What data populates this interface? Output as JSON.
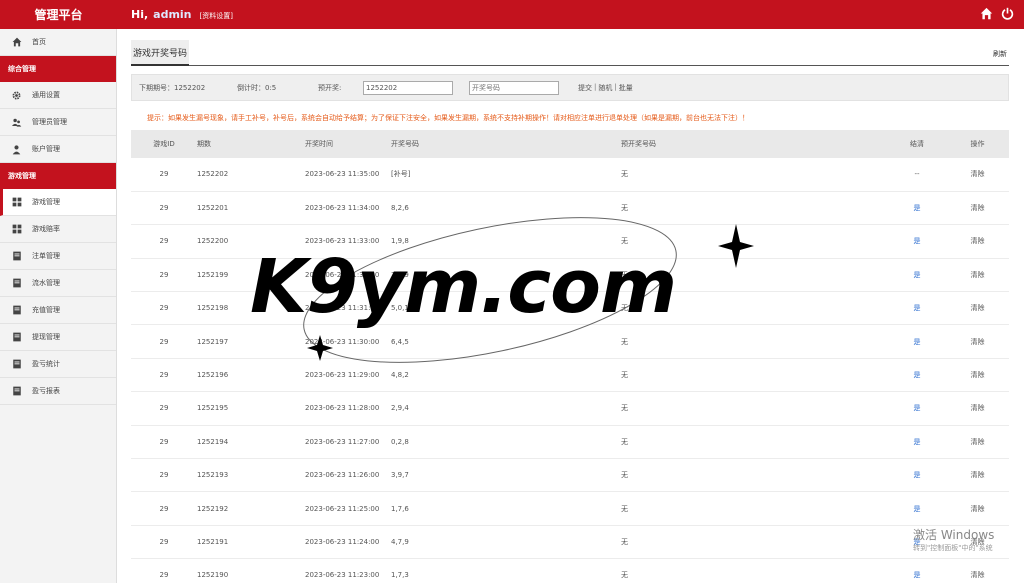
{
  "header": {
    "brand": "管理平台",
    "greeting": "Hi,",
    "username": "admin",
    "profile_link": "[资料设置]",
    "icons": [
      "home-icon",
      "power-icon"
    ]
  },
  "sidebar": {
    "items_top": [
      {
        "label": "首页",
        "icon": "home-icon"
      }
    ],
    "section1": "综合管理",
    "items_s1": [
      {
        "label": "通用设置",
        "icon": "gear-icon"
      },
      {
        "label": "管理员管理",
        "icon": "users-icon"
      },
      {
        "label": "账户管理",
        "icon": "user-icon"
      }
    ],
    "section2": "游戏管理",
    "items_s2": [
      {
        "label": "游戏管理",
        "icon": "grid-icon"
      },
      {
        "label": "游戏赔率",
        "icon": "grid-icon"
      },
      {
        "label": "注单管理",
        "icon": "doc-icon"
      },
      {
        "label": "流水管理",
        "icon": "doc-icon"
      },
      {
        "label": "充值管理",
        "icon": "doc-icon"
      },
      {
        "label": "提现管理",
        "icon": "doc-icon"
      },
      {
        "label": "盈亏统计",
        "icon": "doc-icon"
      },
      {
        "label": "盈亏报表",
        "icon": "doc-icon"
      }
    ]
  },
  "page": {
    "title": "游戏开奖号码",
    "refresh": "刷新"
  },
  "filter": {
    "next_issue": "下期期号：1252202",
    "countdown": "倒计时：0:5",
    "preset_label": "预开奖:",
    "issue_input_value": "1252202",
    "number_placeholder": "开奖号码",
    "submit": "提交",
    "random": "随机",
    "batch": "批量",
    "sep": "|"
  },
  "notice": "提示：如果发生漏号现象，请手工补号，补号后，系统会自动给予结算；为了保证下注安全，如果发生漏期，系统不支持补期操作！请对相应注单进行退单处理（如果是漏期，前台也无法下注）！",
  "table": {
    "headers": [
      "游戏ID",
      "期数",
      "开奖时间",
      "开奖号码",
      "预开奖号码",
      "结清",
      "操作"
    ],
    "rows": [
      {
        "id": "29",
        "issue": "1252202",
        "time": "2023-06-23 11:35:00",
        "number": "[补号]",
        "preset": "无",
        "settled": "--",
        "action": "清除"
      },
      {
        "id": "29",
        "issue": "1252201",
        "time": "2023-06-23 11:34:00",
        "number": "8,2,6",
        "preset": "无",
        "settled": "是",
        "action": "清除"
      },
      {
        "id": "29",
        "issue": "1252200",
        "time": "2023-06-23 11:33:00",
        "number": "1,9,8",
        "preset": "无",
        "settled": "是",
        "action": "清除"
      },
      {
        "id": "29",
        "issue": "1252199",
        "time": "2023-06-23 11:32:00",
        "number": "7,3,9",
        "preset": "无",
        "settled": "是",
        "action": "清除"
      },
      {
        "id": "29",
        "issue": "1252198",
        "time": "2023-06-23 11:31:00",
        "number": "5,0,1",
        "preset": "无",
        "settled": "是",
        "action": "清除"
      },
      {
        "id": "29",
        "issue": "1252197",
        "time": "2023-06-23 11:30:00",
        "number": "6,4,5",
        "preset": "无",
        "settled": "是",
        "action": "清除"
      },
      {
        "id": "29",
        "issue": "1252196",
        "time": "2023-06-23 11:29:00",
        "number": "4,8,2",
        "preset": "无",
        "settled": "是",
        "action": "清除"
      },
      {
        "id": "29",
        "issue": "1252195",
        "time": "2023-06-23 11:28:00",
        "number": "2,9,4",
        "preset": "无",
        "settled": "是",
        "action": "清除"
      },
      {
        "id": "29",
        "issue": "1252194",
        "time": "2023-06-23 11:27:00",
        "number": "0,2,8",
        "preset": "无",
        "settled": "是",
        "action": "清除"
      },
      {
        "id": "29",
        "issue": "1252193",
        "time": "2023-06-23 11:26:00",
        "number": "3,9,7",
        "preset": "无",
        "settled": "是",
        "action": "清除"
      },
      {
        "id": "29",
        "issue": "1252192",
        "time": "2023-06-23 11:25:00",
        "number": "1,7,6",
        "preset": "无",
        "settled": "是",
        "action": "清除"
      },
      {
        "id": "29",
        "issue": "1252191",
        "time": "2023-06-23 11:24:00",
        "number": "4,7,9",
        "preset": "无",
        "settled": "是",
        "action": "清除"
      },
      {
        "id": "29",
        "issue": "1252190",
        "time": "2023-06-23 11:23:00",
        "number": "1,7,3",
        "preset": "无",
        "settled": "是",
        "action": "清除"
      }
    ]
  },
  "watermark": {
    "text": "K9ym.com",
    "windows_line1": "激活 Windows",
    "windows_line2": "转到\"控制面板\"中的\"系统"
  },
  "colors": {
    "brand_red": "#c3121e",
    "notice_orange": "#e55a18",
    "link_blue": "#2f6fd0"
  }
}
